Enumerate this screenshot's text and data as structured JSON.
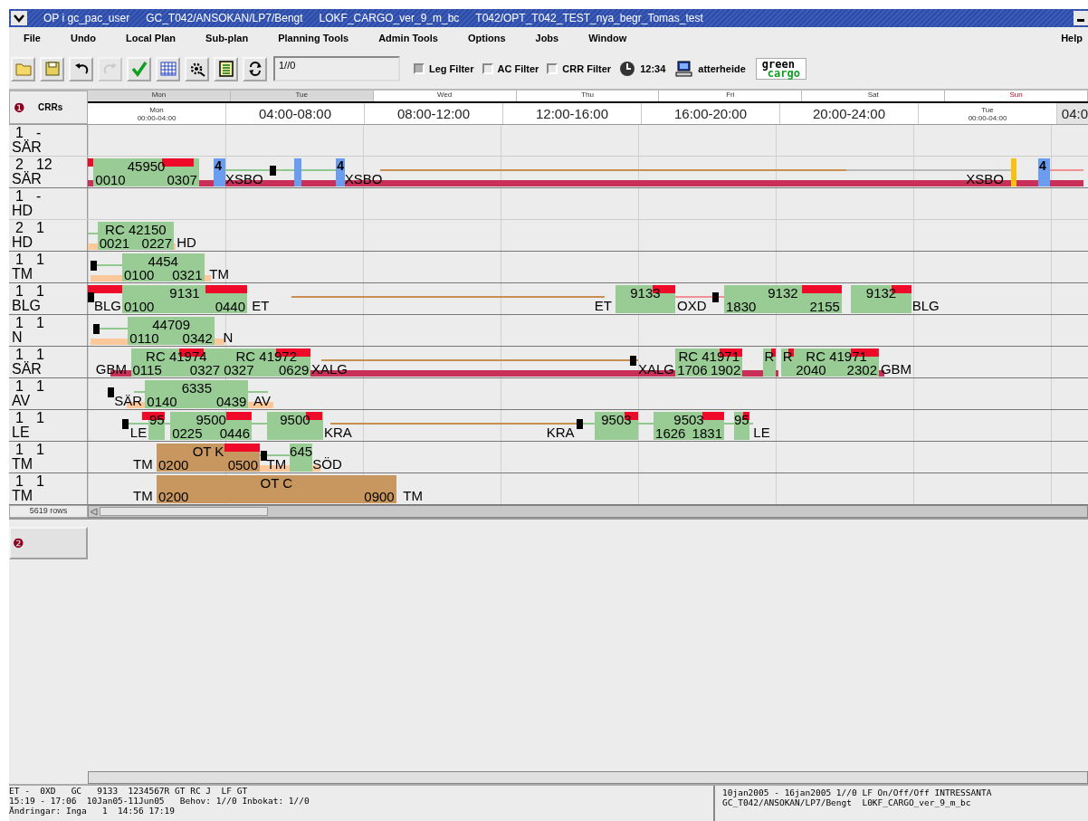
{
  "window": {
    "title_parts": [
      "OP i gc_pac_user",
      "GC_T042/ANSOKAN/LP7/Bengt",
      "LOKF_CARGO_ver_9_m_bc",
      "T042/OPT_T042_TEST_nya_begr_Tomas_test"
    ]
  },
  "menu": [
    "File",
    "Undo",
    "Local Plan",
    "Sub-plan",
    "Planning Tools",
    "Admin Tools",
    "Options",
    "Jobs",
    "Window"
  ],
  "help_menu": "Help",
  "toolbar": {
    "buttons": [
      {
        "kind": "open",
        "disabled": false
      },
      {
        "kind": "save",
        "disabled": false
      },
      {
        "kind": "undo",
        "disabled": false
      },
      {
        "kind": "redo",
        "disabled": true
      },
      {
        "kind": "check",
        "disabled": false
      },
      {
        "kind": "grid",
        "disabled": false
      },
      {
        "kind": "tool",
        "disabled": false
      },
      {
        "kind": "list",
        "disabled": false
      },
      {
        "kind": "refresh",
        "disabled": false
      }
    ],
    "field": "1//0",
    "filters": [
      {
        "label": "Leg Filter",
        "checked": true
      },
      {
        "label": "AC Filter",
        "checked": false
      },
      {
        "label": "CRR Filter",
        "checked": false
      }
    ],
    "clock": "12:34",
    "user": "atterheide",
    "logo": [
      "green",
      "cargo"
    ]
  },
  "gantt": {
    "panel_mark": "❶",
    "column_label": "CRRs",
    "days": [
      {
        "label": "Mon",
        "holiday": false
      },
      {
        "label": "Tue",
        "holiday": false
      },
      {
        "label": "Wed",
        "holiday": false
      },
      {
        "label": "Thu",
        "holiday": false
      },
      {
        "label": "Fri",
        "holiday": false
      },
      {
        "label": "Sat",
        "holiday": false
      },
      {
        "label": "Sun",
        "holiday": true
      }
    ],
    "slots": [
      {
        "kind": "small",
        "day": "Mon",
        "range": "00:00-04:00"
      },
      {
        "kind": "large",
        "range": "04:00-08:00"
      },
      {
        "kind": "large",
        "range": "08:00-12:00"
      },
      {
        "kind": "large",
        "range": "12:00-16:00"
      },
      {
        "kind": "large",
        "range": "16:00-20:00"
      },
      {
        "kind": "large",
        "range": "20:00-24:00"
      },
      {
        "kind": "small",
        "day": "Tue",
        "range": "00:00-04:00"
      },
      {
        "kind": "cut",
        "range": "04:0"
      }
    ],
    "rows": [
      {
        "count_a": "1",
        "count_b": "-",
        "station": "SÄR",
        "items": []
      },
      {
        "count_a": "2",
        "count_b": "12",
        "station": "SÄR",
        "items": [
          {
            "kind": "base",
            "color": "#c8305a"
          },
          {
            "kind": "flag"
          },
          {
            "kind": "block",
            "color": "#98cc94",
            "label": "45950",
            "from": "0010",
            "to": "0307",
            "warning": true
          },
          {
            "kind": "slot",
            "color": "#6a9cf0",
            "text": "4"
          },
          {
            "kind": "station",
            "text": "XSBO"
          },
          {
            "kind": "link",
            "color": "#90c890"
          },
          {
            "kind": "marker"
          },
          {
            "kind": "slot",
            "color": "#6a9cf0"
          },
          {
            "kind": "slot",
            "color": "#6a9cf0",
            "text": "4"
          },
          {
            "kind": "station",
            "text": "XSBO"
          },
          {
            "kind": "link",
            "color": "#c89050"
          },
          {
            "kind": "link",
            "color": "#b8b8b8"
          },
          {
            "kind": "station",
            "text": "XSBO"
          },
          {
            "kind": "slot",
            "color": "#f8c010"
          },
          {
            "kind": "slot",
            "color": "#6a9cf0",
            "text": "4"
          },
          {
            "kind": "link",
            "color": "#f09090"
          }
        ]
      },
      {
        "count_a": "1",
        "count_b": "-",
        "station": "HD",
        "items": []
      },
      {
        "count_a": "2",
        "count_b": "1",
        "station": "HD",
        "items": [
          {
            "kind": "base",
            "color": "#fcc89a"
          },
          {
            "kind": "link",
            "color": "#90c890"
          },
          {
            "kind": "block",
            "color": "#98cc94",
            "label": "RC 42150",
            "from": "0021",
            "to": "0227",
            "warning": false
          },
          {
            "kind": "station",
            "text": "HD"
          }
        ]
      },
      {
        "count_a": "1",
        "count_b": "1",
        "station": "TM",
        "items": [
          {
            "kind": "marker"
          },
          {
            "kind": "base",
            "color": "#fcc89a"
          },
          {
            "kind": "link",
            "color": "#90c890"
          },
          {
            "kind": "block",
            "color": "#98cc94",
            "label": "4454",
            "from": "0100",
            "to": "0321",
            "warning": false
          },
          {
            "kind": "station",
            "text": "TM"
          }
        ]
      },
      {
        "count_a": "1",
        "count_b": "1",
        "station": "BLG",
        "items": [
          {
            "kind": "marker"
          },
          {
            "kind": "flag"
          },
          {
            "kind": "station",
            "text": "BLG"
          },
          {
            "kind": "block",
            "color": "#98cc94",
            "label": "9131",
            "from": "0100",
            "to": "0440",
            "warning": true
          },
          {
            "kind": "station",
            "text": "ET"
          },
          {
            "kind": "link",
            "color": "#c89050"
          },
          {
            "kind": "station",
            "text": "ET"
          },
          {
            "kind": "block",
            "color": "#98cc94",
            "label": "9133",
            "warning": true
          },
          {
            "kind": "link",
            "color": "#f09090"
          },
          {
            "kind": "station",
            "text": "OXD"
          },
          {
            "kind": "marker"
          },
          {
            "kind": "block",
            "color": "#98cc94",
            "label": "9132",
            "from": "1830",
            "to": "2155",
            "warning": true
          },
          {
            "kind": "block",
            "color": "#98cc94",
            "label": "9132",
            "warning": true
          },
          {
            "kind": "station",
            "text": "BLG"
          }
        ]
      },
      {
        "count_a": "1",
        "count_b": "1",
        "station": "N",
        "items": [
          {
            "kind": "base",
            "color": "#fcc89a"
          },
          {
            "kind": "marker"
          },
          {
            "kind": "link",
            "color": "#90c890"
          },
          {
            "kind": "block",
            "color": "#98cc94",
            "label": "44709",
            "from": "0110",
            "to": "0342",
            "warning": false
          },
          {
            "kind": "station",
            "text": "N"
          }
        ]
      },
      {
        "count_a": "1",
        "count_b": "1",
        "station": "SÄR",
        "items": [
          {
            "kind": "station",
            "text": "GBM"
          },
          {
            "kind": "base",
            "color": "#c8305a"
          },
          {
            "kind": "block",
            "color": "#98cc94",
            "label": "RC 41974",
            "from": "0115",
            "to": "0327",
            "warning": true
          },
          {
            "kind": "block",
            "color": "#98cc94",
            "label": "RC 41972",
            "from": "0327",
            "to": "0629",
            "warning": true
          },
          {
            "kind": "station",
            "text": "XALG"
          },
          {
            "kind": "link",
            "color": "#c89050"
          },
          {
            "kind": "marker"
          },
          {
            "kind": "station",
            "text": "XALG"
          },
          {
            "kind": "block",
            "color": "#98cc94",
            "label": "RC 41971",
            "from": "1706",
            "to": "1902",
            "warning": true
          },
          {
            "kind": "base",
            "color": "#c8305a"
          },
          {
            "kind": "block",
            "color": "#98cc94",
            "label": "R",
            "warning": true
          },
          {
            "kind": "block",
            "color": "#98cc94",
            "label": "R",
            "warning": true
          },
          {
            "kind": "block",
            "color": "#98cc94",
            "label": "RC 41971",
            "from": "2040",
            "to": "2302",
            "warning": true
          },
          {
            "kind": "base",
            "color": "#c8305a"
          },
          {
            "kind": "station",
            "text": "GBM"
          }
        ]
      },
      {
        "count_a": "1",
        "count_b": "1",
        "station": "AV",
        "items": [
          {
            "kind": "marker"
          },
          {
            "kind": "station",
            "text": "SÄR"
          },
          {
            "kind": "base",
            "color": "#fcc89a"
          },
          {
            "kind": "link",
            "color": "#90c890"
          },
          {
            "kind": "block",
            "color": "#98cc94",
            "label": "6335",
            "from": "0140",
            "to": "0439",
            "warning": false
          },
          {
            "kind": "station",
            "text": "AV"
          }
        ]
      },
      {
        "count_a": "1",
        "count_b": "1",
        "station": "LE",
        "items": [
          {
            "kind": "marker"
          },
          {
            "kind": "link",
            "color": "#90c890"
          },
          {
            "kind": "station",
            "text": "LE"
          },
          {
            "kind": "flag"
          },
          {
            "kind": "block",
            "color": "#98cc94",
            "label": "95",
            "warning": true
          },
          {
            "kind": "block",
            "color": "#98cc94",
            "label": "9500",
            "from": "0225",
            "to": "0446",
            "warning": true
          },
          {
            "kind": "block",
            "color": "#98cc94",
            "label": "9500",
            "warning": true
          },
          {
            "kind": "station",
            "text": "KRA"
          },
          {
            "kind": "link",
            "color": "#c89050"
          },
          {
            "kind": "station",
            "text": "KRA"
          },
          {
            "kind": "marker"
          },
          {
            "kind": "link",
            "color": "#90c890"
          },
          {
            "kind": "block",
            "color": "#98cc94",
            "label": "9503",
            "warning": true
          },
          {
            "kind": "block",
            "color": "#98cc94",
            "label": "9503",
            "from": "1626",
            "to": "1831",
            "warning": true
          },
          {
            "kind": "block",
            "color": "#98cc94",
            "label": "95",
            "warning": true
          },
          {
            "kind": "station",
            "text": "LE"
          }
        ]
      },
      {
        "count_a": "1",
        "count_b": "1",
        "station": "TM",
        "items": [
          {
            "kind": "station",
            "text": "TM"
          },
          {
            "kind": "block",
            "color": "#c8965f",
            "label": "OT K",
            "from": "0200",
            "to": "0500",
            "warning": true
          },
          {
            "kind": "base",
            "color": "#fcc89a"
          },
          {
            "kind": "link",
            "color": "#90c890"
          },
          {
            "kind": "marker"
          },
          {
            "kind": "station",
            "text": "TM"
          },
          {
            "kind": "block",
            "color": "#98cc94",
            "label": "645",
            "warning": false
          },
          {
            "kind": "station",
            "text": "SÖD"
          }
        ]
      },
      {
        "count_a": "1",
        "count_b": "1",
        "station": "TM",
        "items": [
          {
            "kind": "station",
            "text": "TM"
          },
          {
            "kind": "block",
            "color": "#c8965f",
            "label": "OT C",
            "from": "0200",
            "to": "0900",
            "warning": false
          },
          {
            "kind": "station",
            "text": "TM"
          }
        ]
      }
    ],
    "row_count": "5619 rows"
  },
  "panel_2": {
    "mark": "❷"
  },
  "status_bar": {
    "left": [
      "ET -  0XD   GC   9133  1234567R GT RC J  LF GT",
      "15:19 - 17:06  10Jan05-11Jun05   Behov: 1//0 Inbokat: 1//0",
      "Ändringar: Inga   1  14:56 17:19"
    ],
    "right": [
      "10jan2005 - 16jan2005 1//0 LF On/Off/Off INTRESSANTA",
      "GC_T042/ANSOKAN/LP7/Bengt  L0KF_CARGO_ver_9_m_bc"
    ]
  }
}
